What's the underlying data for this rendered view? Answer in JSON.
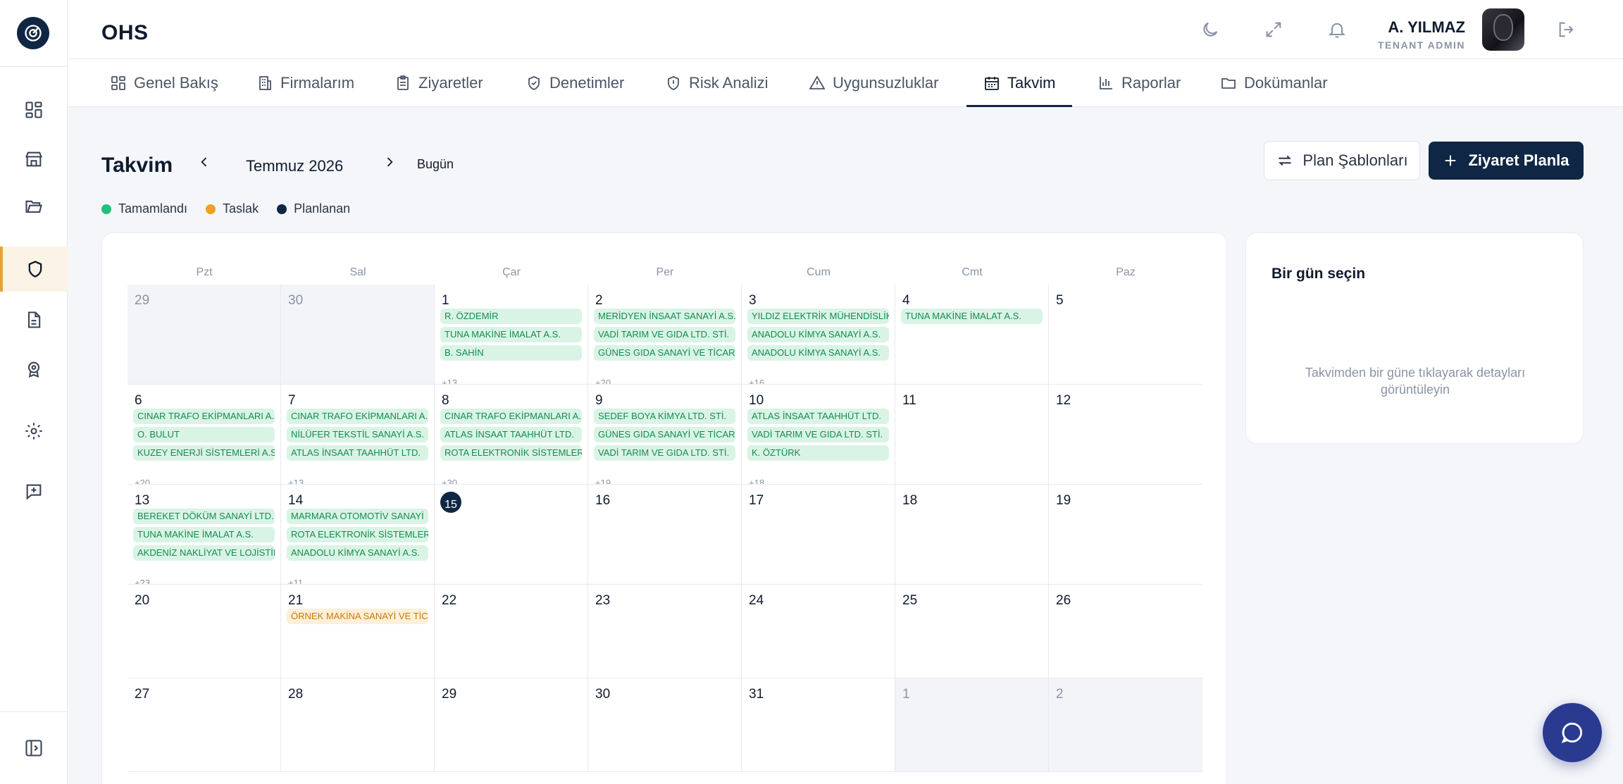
{
  "app": {
    "brand": "OHS"
  },
  "user": {
    "name": "A. YILMAZ",
    "role": "TENANT ADMIN"
  },
  "tabs": [
    {
      "label": "Genel Bakış",
      "icon": "dashboard-grid-icon",
      "active": false
    },
    {
      "label": "Firmalarım",
      "icon": "building-icon",
      "active": false
    },
    {
      "label": "Ziyaretler",
      "icon": "clipboard-icon",
      "active": false
    },
    {
      "label": "Denetimler",
      "icon": "shield-check-icon",
      "active": false
    },
    {
      "label": "Risk Analizi",
      "icon": "shield-alert-icon",
      "active": false
    },
    {
      "label": "Uygunsuzluklar",
      "icon": "warning-triangle-icon",
      "active": false
    },
    {
      "label": "Takvim",
      "icon": "calendar-icon",
      "active": true
    },
    {
      "label": "Raporlar",
      "icon": "bar-chart-icon",
      "active": false
    },
    {
      "label": "Dokümanlar",
      "icon": "folder-icon",
      "active": false
    }
  ],
  "sidebar": {
    "items": [
      {
        "icon": "dashboard-icon",
        "active": false
      },
      {
        "icon": "store-icon",
        "active": false
      },
      {
        "icon": "folder-open-icon",
        "active": false
      },
      {
        "icon": "shield-icon",
        "active": true
      },
      {
        "icon": "document-icon",
        "active": false
      },
      {
        "icon": "award-icon",
        "active": false
      },
      {
        "icon": "settings-gear-icon",
        "active": false
      },
      {
        "icon": "message-plus-icon",
        "active": false
      }
    ],
    "collapse_icon": "sidebar-collapse-icon"
  },
  "calendar": {
    "title": "Takvim",
    "month_label": "Temmuz 2026",
    "today_label": "Bugün",
    "plan_templates_label": "Plan Şablonları",
    "schedule_visit_label": "Ziyaret Planla",
    "legend": [
      {
        "label": "Tamamlandı",
        "color": "#22c07a"
      },
      {
        "label": "Taslak",
        "color": "#f0a020"
      },
      {
        "label": "Planlanan",
        "color": "#0f2744"
      }
    ],
    "weekdays": [
      "Pzt",
      "Sal",
      "Çar",
      "Per",
      "Cum",
      "Cmt",
      "Paz"
    ],
    "weeks": [
      [
        {
          "day": "29",
          "muted": true,
          "events": []
        },
        {
          "day": "30",
          "muted": true,
          "events": []
        },
        {
          "day": "1",
          "events": [
            "R. ÖZDEMİR",
            "TUNA MAKİNE İMALAT A.S.",
            "B. SAHİN"
          ],
          "more": "+13"
        },
        {
          "day": "2",
          "events": [
            "MERİDYEN İNSAAT SANAYİ A.S.",
            "VADİ TARIM VE GIDA LTD. STİ.",
            "GÜNES GIDA SANAYİ VE TİCARET"
          ],
          "more": "+20"
        },
        {
          "day": "3",
          "events": [
            "YILDIZ ELEKTRİK MÜHENDİSLİK",
            "ANADOLU KİMYA SANAYİ A.S.",
            "ANADOLU KİMYA SANAYİ A.S."
          ],
          "more": "+16"
        },
        {
          "day": "4",
          "events": [
            "TUNA MAKİNE İMALAT A.S."
          ]
        },
        {
          "day": "5",
          "events": []
        }
      ],
      [
        {
          "day": "6",
          "events": [
            "CINAR TRAFO EKİPMANLARI A.S.",
            "O. BULUT",
            "KUZEY ENERJİ SİSTEMLERİ A.S."
          ],
          "more": "+20"
        },
        {
          "day": "7",
          "events": [
            "CINAR TRAFO EKİPMANLARI A.S.",
            "NİLÜFER TEKSTİL SANAYİ A.S.",
            "ATLAS İNSAAT TAAHHÜT LTD."
          ],
          "more": "+13"
        },
        {
          "day": "8",
          "events": [
            "CINAR TRAFO EKİPMANLARI A.S.",
            "ATLAS İNSAAT TAAHHÜT LTD.",
            "ROTA ELEKTRONİK SİSTEMLERİ"
          ],
          "more": "+30"
        },
        {
          "day": "9",
          "events": [
            "SEDEF BOYA KİMYA LTD. STİ.",
            "GÜNES GIDA SANAYİ VE TİCARET",
            "VADİ TARIM VE GIDA LTD. STİ."
          ],
          "more": "+19"
        },
        {
          "day": "10",
          "events": [
            "ATLAS İNSAAT TAAHHÜT LTD.",
            "VADİ TARIM VE GIDA LTD. STİ.",
            "K. ÖZTÜRK"
          ],
          "more": "+18"
        },
        {
          "day": "11",
          "events": []
        },
        {
          "day": "12",
          "events": []
        }
      ],
      [
        {
          "day": "13",
          "events": [
            "BEREKET DÖKÜM SANAYİ LTD.",
            "TUNA MAKİNE İMALAT A.S.",
            "AKDENİZ NAKLİYAT VE LOJİSTİK"
          ],
          "more": "+23"
        },
        {
          "day": "14",
          "events": [
            "MARMARA OTOMOTİV SANAYİ",
            "ROTA ELEKTRONİK SİSTEMLERİ",
            "ANADOLU KİMYA SANAYİ A.S."
          ],
          "more": "+11"
        },
        {
          "day": "15",
          "today": true,
          "events": []
        },
        {
          "day": "16",
          "events": []
        },
        {
          "day": "17",
          "events": []
        },
        {
          "day": "18",
          "events": []
        },
        {
          "day": "19",
          "events": []
        }
      ],
      [
        {
          "day": "20",
          "events": []
        },
        {
          "day": "21",
          "events": [],
          "draft_events": [
            "ÖRNEK MAKİNA SANAYİ VE TİCARET"
          ]
        },
        {
          "day": "22",
          "events": []
        },
        {
          "day": "23",
          "events": []
        },
        {
          "day": "24",
          "events": []
        },
        {
          "day": "25",
          "events": []
        },
        {
          "day": "26",
          "events": []
        }
      ],
      [
        {
          "day": "27",
          "events": []
        },
        {
          "day": "28",
          "events": []
        },
        {
          "day": "29",
          "events": []
        },
        {
          "day": "30",
          "events": []
        },
        {
          "day": "31",
          "events": []
        },
        {
          "day": "1",
          "muted": true,
          "events": []
        },
        {
          "day": "2",
          "muted": true,
          "events": []
        }
      ]
    ]
  },
  "detail_panel": {
    "title": "Bir gün seçin",
    "hint": "Takvimden bir güne tıklayarak detayları görüntüleyin"
  }
}
